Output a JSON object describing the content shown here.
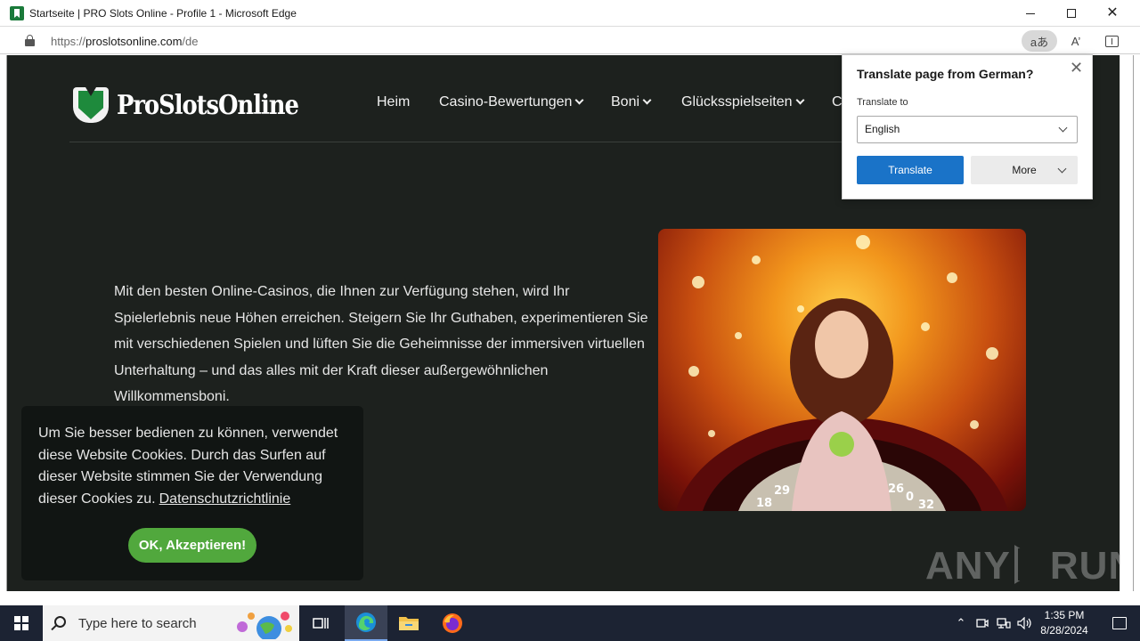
{
  "window": {
    "title": "Startseite | PRO Slots Online - Profile 1 - Microsoft Edge"
  },
  "address_bar": {
    "url_scheme": "https://",
    "url_host": "proslotsonline.com",
    "url_path": "/de",
    "translate_icon_glyph": "aあ",
    "read_aloud_glyph": "A’"
  },
  "site": {
    "logo_text": "ProSlotsOnline",
    "nav": [
      {
        "label": "Heim",
        "has_dropdown": false
      },
      {
        "label": "Casino-Bewertungen",
        "has_dropdown": true
      },
      {
        "label": "Boni",
        "has_dropdown": true
      },
      {
        "label": "Glücksspielseiten",
        "has_dropdown": true
      },
      {
        "label": "C",
        "has_dropdown": false
      }
    ],
    "intro_text": "Mit den besten Online-Casinos, die Ihnen zur Verfügung stehen, wird Ihr Spielerlebnis neue Höhen erreichen. Steigern Sie Ihr Guthaben, experimentieren Sie mit verschiedenen Spielen und lüften Sie die Geheimnisse der immersiven virtuellen Unterhaltung – und das alles mit der Kraft dieser außergewöhnlichen Willkommensboni.",
    "hero_wheel_numbers": [
      "18",
      "29",
      "26",
      "0",
      "32"
    ]
  },
  "cookie_banner": {
    "message": "Um Sie besser bedienen zu können, verwendet diese Website Cookies. Durch das Surfen auf dieser Website stimmen Sie der Verwendung dieser Cookies zu.",
    "policy_link": "Datenschutzrichtlinie",
    "accept_label": "OK, Akzeptieren!"
  },
  "translate_popup": {
    "heading": "Translate page from German?",
    "to_label": "Translate to",
    "selected_language": "English",
    "translate_button": "Translate",
    "more_button": "More"
  },
  "watermark": {
    "left": "ANY",
    "right": "RUN"
  },
  "taskbar": {
    "search_placeholder": "Type here to search",
    "time": "1:35 PM",
    "date": "8/28/2024"
  },
  "colors": {
    "page_background": "#1d211e",
    "accent_green": "#51a83d",
    "edge_blue": "#1a73c8",
    "taskbar": "#1c2333"
  }
}
